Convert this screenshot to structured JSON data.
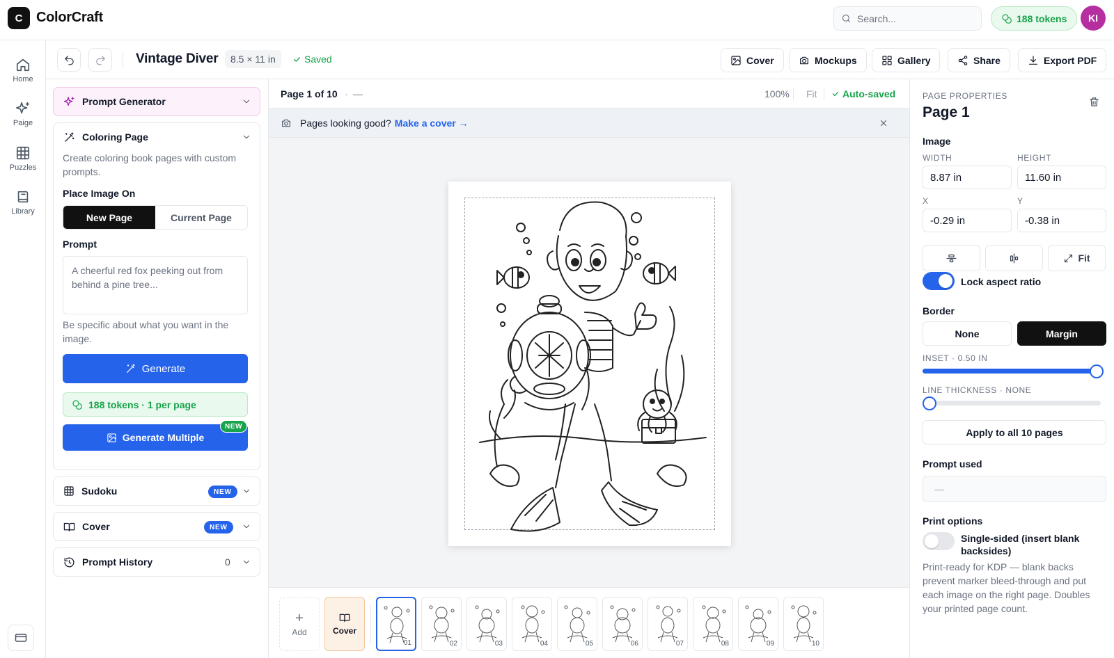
{
  "app": {
    "logo_letter": "C",
    "title": "ColorCraft"
  },
  "search": {
    "placeholder": "Search..."
  },
  "header": {
    "tokens": "188 tokens",
    "avatar_initials": "KI"
  },
  "nav": {
    "items": [
      {
        "label": "Home",
        "icon": "home-icon"
      },
      {
        "label": "Paige",
        "icon": "sparkles-icon"
      },
      {
        "label": "Puzzles",
        "icon": "grid-icon"
      },
      {
        "label": "Library",
        "icon": "book-icon"
      }
    ]
  },
  "document": {
    "title": "Vintage Diver",
    "size": "8.5 × 11 in",
    "status": "Saved"
  },
  "toolbar": {
    "cover": "Cover",
    "mockups": "Mockups",
    "gallery": "Gallery",
    "share": "Share",
    "export": "Export PDF"
  },
  "left_panel": {
    "prompt_generator": {
      "title": "Prompt Generator"
    },
    "coloring_page": {
      "title": "Coloring Page",
      "description": "Create coloring book pages with custom prompts.",
      "place_label": "Place Image On",
      "segment_options": [
        "New Page",
        "Current Page"
      ],
      "prompt_label": "Prompt",
      "prompt_placeholder": "A cheerful red fox peeking out from behind a pine tree...",
      "prompt_hint": "Be specific about what you want in the image.",
      "generate_label": "Generate",
      "tokens_note": "188 tokens · 1 per page",
      "generate_multiple_label": "Generate Multiple",
      "new_badge": "NEW"
    },
    "sudoku": {
      "title": "Sudoku",
      "badge": "NEW"
    },
    "cover": {
      "title": "Cover",
      "badge": "NEW"
    },
    "prompt_history": {
      "title": "Prompt History",
      "count": "0"
    }
  },
  "canvas": {
    "page_indicator": "Page 1 of 10",
    "page_dash": "—",
    "zoom": "100%",
    "fit": "Fit",
    "autosave": "Auto-saved",
    "banner_text": "Pages looking good?",
    "banner_link": "Make a cover →"
  },
  "thumbnails": {
    "add_label": "Add",
    "cover_label": "Cover",
    "pages": [
      "01",
      "02",
      "03",
      "04",
      "05",
      "06",
      "07",
      "08",
      "09",
      "10"
    ],
    "selected_index": 0
  },
  "properties": {
    "section_caption": "PAGE PROPERTIES",
    "title": "Page 1",
    "image_label": "Image",
    "width_caption": "WIDTH",
    "height_caption": "HEIGHT",
    "width": "8.87 in",
    "height": "11.60 in",
    "x_caption": "X",
    "y_caption": "Y",
    "x": "-0.29 in",
    "y": "-0.38 in",
    "fit_label": "Fit",
    "lock_aspect_label": "Lock aspect ratio",
    "lock_aspect_on": true,
    "border_label": "Border",
    "border_options": [
      "None",
      "Margin"
    ],
    "border_selected": "Margin",
    "inset_caption": "INSET · 0.50 IN",
    "inset_fraction": 1.0,
    "thickness_caption": "LINE THICKNESS · NONE",
    "thickness_fraction": 0.0,
    "apply_all_label": "Apply to all 10 pages",
    "prompt_used_label": "Prompt used",
    "prompt_used_value": "—",
    "print_options_label": "Print options",
    "single_sided_label": "Single-sided (insert blank backsides)",
    "single_sided_on": false,
    "print_help": "Print-ready for KDP — blank backs prevent marker bleed-through and put each image on the right page. Doubles your printed page count."
  },
  "colors": {
    "accent": "#2563eb",
    "success": "#16a34a",
    "avatar": "#b62fa0",
    "dark": "#111111"
  }
}
